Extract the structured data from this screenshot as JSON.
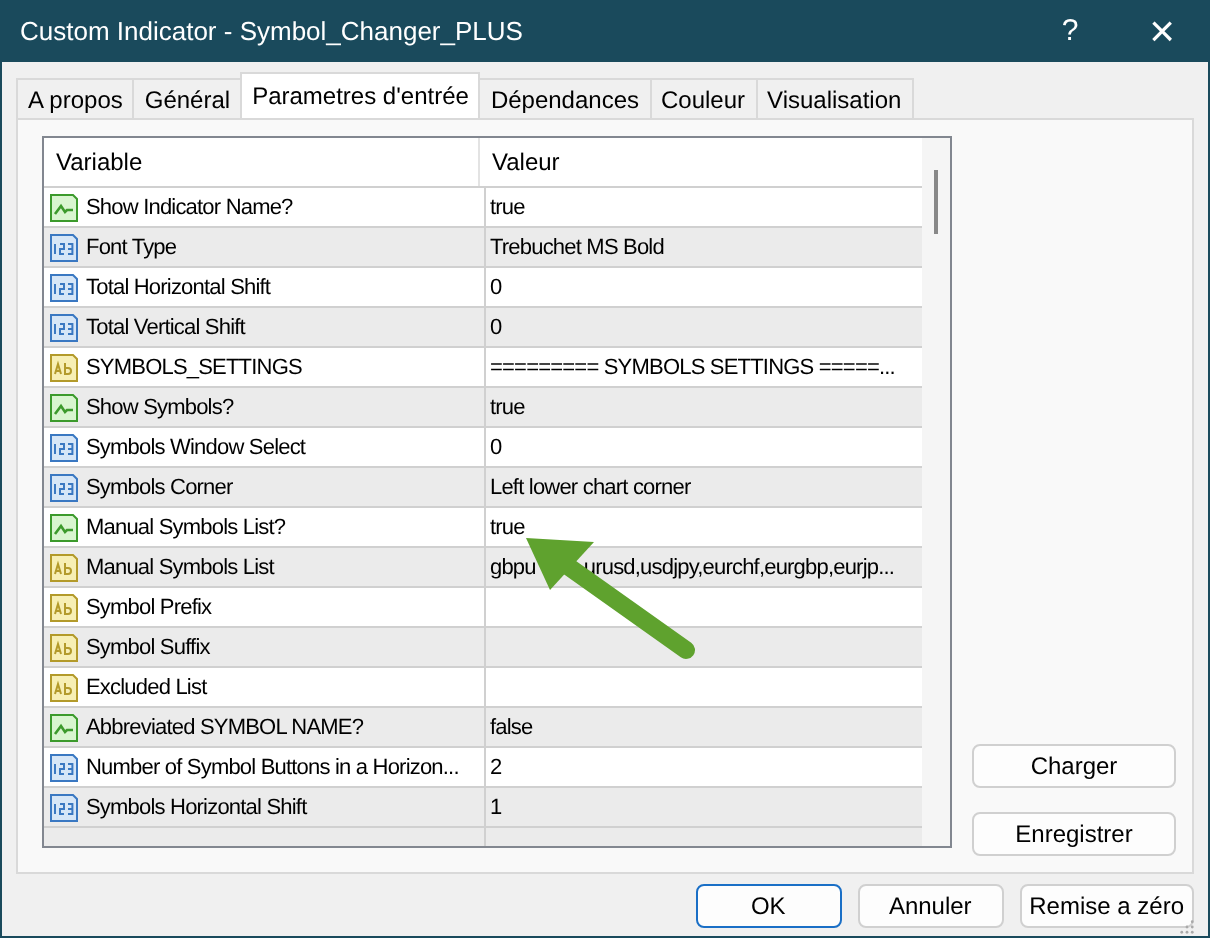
{
  "window": {
    "title": "Custom Indicator - Symbol_Changer_PLUS",
    "help": "?",
    "close": "×"
  },
  "tabs": [
    {
      "label": "A propos",
      "selected": false
    },
    {
      "label": "Général",
      "selected": false
    },
    {
      "label": "Parametres d'entrée",
      "selected": true
    },
    {
      "label": "Dépendances",
      "selected": false
    },
    {
      "label": "Couleur",
      "selected": false
    },
    {
      "label": "Visualisation",
      "selected": false
    }
  ],
  "table": {
    "columns": [
      "Variable",
      "Valeur"
    ],
    "rows": [
      {
        "kind": "bool",
        "variable": "Show Indicator Name?",
        "value": "true"
      },
      {
        "kind": "int",
        "variable": "Font Type",
        "value": "Trebuchet MS Bold"
      },
      {
        "kind": "int",
        "variable": "Total Horizontal Shift",
        "value": "0"
      },
      {
        "kind": "int",
        "variable": "Total Vertical Shift",
        "value": "0"
      },
      {
        "kind": "string",
        "variable": "SYMBOLS_SETTINGS",
        "value": "========= SYMBOLS SETTINGS =====..."
      },
      {
        "kind": "bool",
        "variable": "Show Symbols?",
        "value": "true"
      },
      {
        "kind": "int",
        "variable": "Symbols Window Select",
        "value": "0"
      },
      {
        "kind": "int",
        "variable": "Symbols Corner",
        "value": "Left lower chart corner"
      },
      {
        "kind": "bool",
        "variable": "Manual Symbols List?",
        "value": "true"
      },
      {
        "kind": "string",
        "variable": "Manual Symbols List",
        "value_parts": [
          "gbpu",
          "urusd,usdjpy,eurchf,eurgbp,eurjp..."
        ]
      },
      {
        "kind": "string",
        "variable": "Symbol Prefix"
      },
      {
        "kind": "string",
        "variable": "Symbol Suffix"
      },
      {
        "kind": "string",
        "variable": "Excluded List"
      },
      {
        "kind": "bool",
        "variable": "Abbreviated SYMBOL NAME?",
        "value": "false"
      },
      {
        "kind": "int",
        "variable": "Number of Symbol Buttons in a Horizon...",
        "value": "2"
      },
      {
        "kind": "int",
        "variable": "Symbols Horizontal Shift",
        "value": "1"
      }
    ]
  },
  "side_buttons": [
    "Charger",
    "Enregistrer"
  ],
  "buttons": [
    {
      "label": "OK",
      "default": true
    },
    {
      "label": "Annuler",
      "default": false
    },
    {
      "label": "Remise a zéro",
      "default": false
    }
  ]
}
